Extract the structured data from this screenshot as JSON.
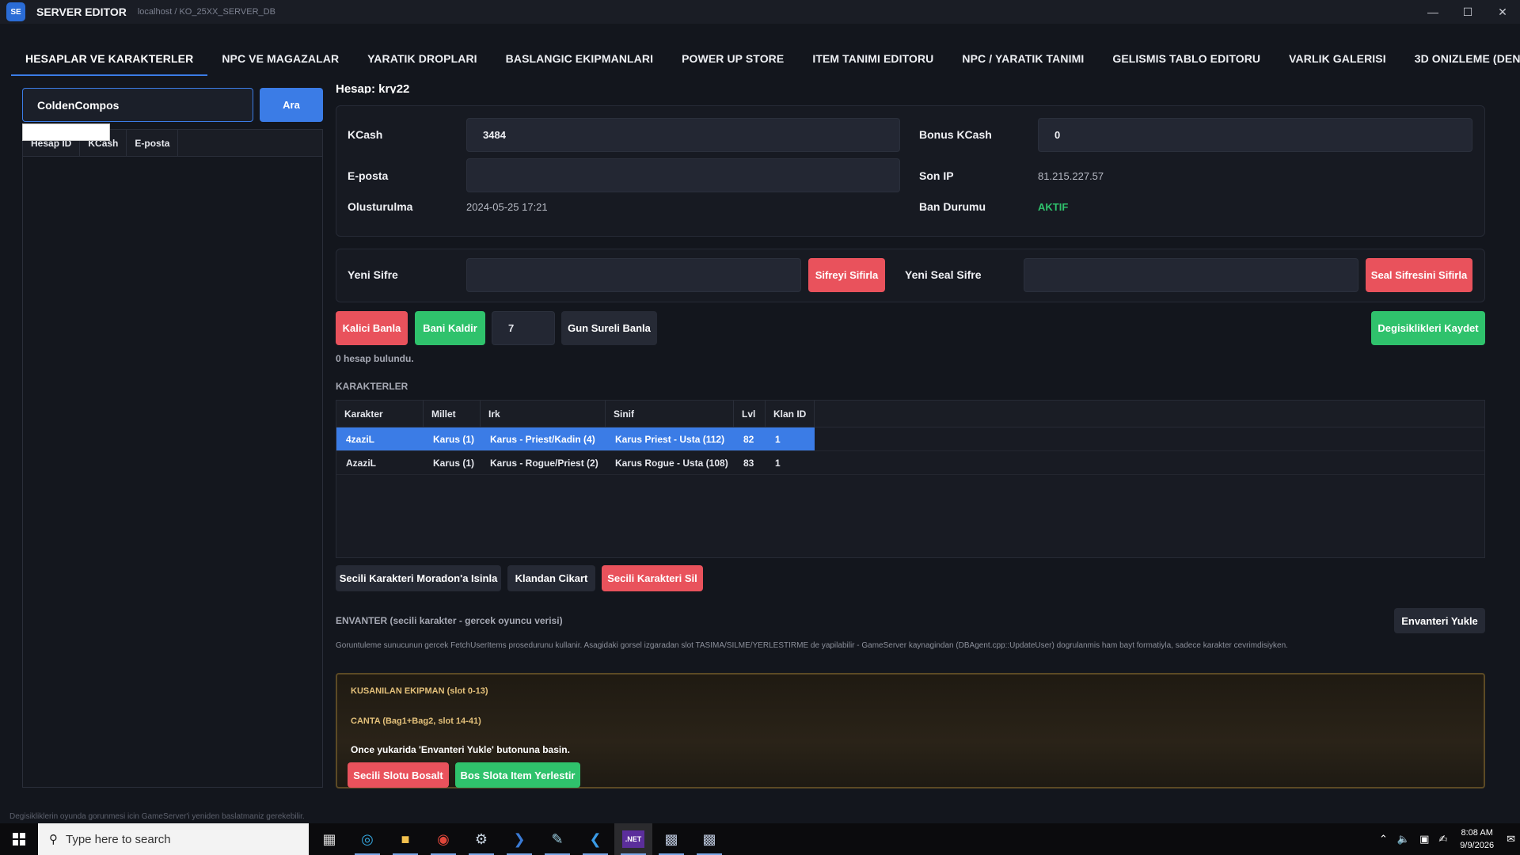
{
  "window": {
    "icon_text": "SE",
    "title": "SERVER EDITOR",
    "path": "localhost / KO_25XX_SERVER_DB",
    "minimize": "—",
    "maximize": "☐",
    "close": "✕"
  },
  "tabs": [
    {
      "label": "HESAPLAR VE KARAKTERLER"
    },
    {
      "label": "NPC VE MAGAZALAR"
    },
    {
      "label": "YARATIK DROPLARI"
    },
    {
      "label": "BASLANGIC EKIPMANLARI"
    },
    {
      "label": "POWER UP STORE"
    },
    {
      "label": "ITEM TANIMI EDITORU"
    },
    {
      "label": "NPC / YARATIK TANIMI"
    },
    {
      "label": "GELISMIS TABLO EDITORU"
    },
    {
      "label": "VARLIK GALERISI"
    },
    {
      "label": "3D ONIZLEME (DENEYSEL)"
    }
  ],
  "search": {
    "value": "ColdenCompos",
    "button": "Ara"
  },
  "left_grid": {
    "columns": [
      "Hesap ID",
      "KCash",
      "E-posta"
    ]
  },
  "account": {
    "title": "Hesap: kry22",
    "kcash_label": "KCash",
    "kcash_value": "3484",
    "bonus_label": "Bonus KCash",
    "bonus_value": "0",
    "email_label": "E-posta",
    "email_value": "",
    "ip_label": "Son IP",
    "ip_value": "81.215.227.57",
    "created_label": "Olusturulma",
    "created_value": "2024-05-25 17:21",
    "ban_label": "Ban Durumu",
    "ban_value": "AKTIF"
  },
  "password": {
    "new_label": "Yeni Sifre",
    "reset_button": "Sifreyi Sifirla",
    "seal_label": "Yeni Seal Sifre",
    "seal_reset_button": "Seal Sifresini Sifirla"
  },
  "ban": {
    "permanent_button": "Kalici Banla",
    "remove_button": "Bani Kaldir",
    "days_value": "7",
    "timed_button": "Gun Sureli Banla",
    "save_button": "Degisiklikleri Kaydet"
  },
  "found_text": "0 hesap bulundu.",
  "characters": {
    "heading": "KARAKTERLER",
    "columns": [
      "Karakter",
      "Millet",
      "Irk",
      "Sinif",
      "Lvl",
      "Klan ID"
    ],
    "rows": [
      {
        "name": "4zaziL",
        "nation": "Karus (1)",
        "race": "Karus - Priest/Kadin (4)",
        "class": "Karus Priest - Usta (112)",
        "lvl": "82",
        "clan": "1"
      },
      {
        "name": "AzaziL",
        "nation": "Karus (1)",
        "race": "Karus - Rogue/Priest (2)",
        "class": "Karus Rogue - Usta (108)",
        "lvl": "83",
        "clan": "1"
      }
    ],
    "teleport_button": "Secili Karakteri Moradon'a Isinla",
    "kick_clan_button": "Klandan Cikart",
    "delete_button": "Secili Karakteri Sil"
  },
  "inventory": {
    "heading": "ENVANTER (secili karakter - gercek oyuncu verisi)",
    "load_button": "Envanteri Yukle",
    "description": "Goruntuleme sunucunun gercek FetchUserItems prosedurunu kullanir. Asagidaki gorsel izgaradan slot TASIMA/SILME/YERLESTIRME de yapilabilir - GameServer kaynagindan (DBAgent.cpp::UpdateUser) dogrulanmis ham bayt formatiyla, sadece karakter cevrimdisiyken.",
    "equip_label": "KUSANILAN EKIPMAN (slot 0-13)",
    "bag_label": "CANTA (Bag1+Bag2, slot 14-41)",
    "hint": "Once yukarida 'Envanteri Yukle' butonuna basin.",
    "clear_slot_button": "Secili Slotu Bosalt",
    "place_item_button": "Bos Slota Item Yerlestir"
  },
  "status": "Degisikliklerin oyunda gorunmesi icin GameServer'i yeniden baslatmaniz gerekebilir.",
  "taskbar": {
    "search_placeholder": "Type here to search",
    "apps": [
      "task-view-icon",
      "edge-icon",
      "file-explorer-icon",
      "chrome-icon",
      "app-icon",
      "powershell-icon",
      "notepad-icon",
      "vscode-icon",
      "dotnet-icon",
      "installer-icon",
      "installer2-icon"
    ],
    "dotnet_label": ".NET",
    "time": "8:08 AM",
    "date": "9/9/2026"
  },
  "colors": {
    "accent": "#3b7ce6",
    "danger": "#e9525c",
    "success": "#2fc26c"
  }
}
